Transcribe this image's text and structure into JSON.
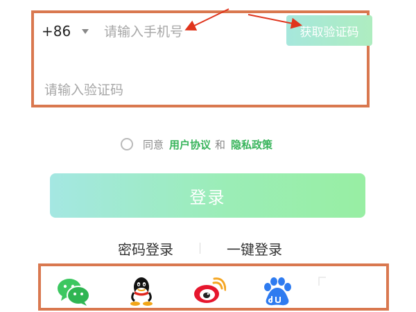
{
  "login": {
    "country_code": "+86",
    "phone_placeholder": "请输入手机号",
    "get_code_label": "获取验证码",
    "code_placeholder": "请输入验证码",
    "agree_prefix": "同意",
    "user_agreement": "用户协议",
    "and": "和",
    "privacy_policy": "隐私政策",
    "login_label": "登录"
  },
  "alt_login": {
    "password_login": "密码登录",
    "one_click_login": "一键登录"
  },
  "social": {
    "icons": [
      "wechat-icon",
      "qq-icon",
      "weibo-icon",
      "baidu-icon"
    ]
  },
  "colors": {
    "annotation": "#d9784f",
    "arrow": "#e0341c",
    "link_green": "#38b45b",
    "button_gradient_start": "#a4e7e2",
    "button_gradient_end": "#98eea3"
  }
}
